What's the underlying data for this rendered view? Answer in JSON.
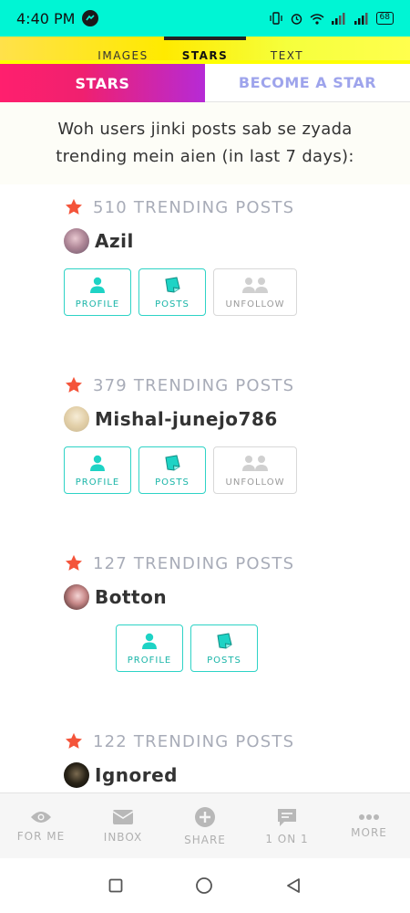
{
  "status_bar": {
    "time": "4:40 PM",
    "battery": "68"
  },
  "top_tabs": [
    {
      "label": "IMAGES",
      "active": false
    },
    {
      "label": "STARS",
      "active": true
    },
    {
      "label": "TEXT",
      "active": false
    }
  ],
  "sub_tabs": {
    "stars": "STARS",
    "become_star": "BECOME A STAR"
  },
  "intro": "Woh users jinki posts sab se zyada trending mein aien (in last 7 days):",
  "entries": [
    {
      "count": "510 TRENDING POSTS",
      "name": "Azil",
      "profile": "PROFILE",
      "posts": "POSTS",
      "unfollow": "UNFOLLOW"
    },
    {
      "count": "379 TRENDING POSTS",
      "name": "Mishal-junejo786",
      "profile": "PROFILE",
      "posts": "POSTS",
      "unfollow": "UNFOLLOW"
    },
    {
      "count": "127 TRENDING POSTS",
      "name": "Botton",
      "profile": "PROFILE",
      "posts": "POSTS"
    },
    {
      "count": "122 TRENDING POSTS",
      "name": "Ignored"
    }
  ],
  "bottom_nav": [
    {
      "label": "FOR ME",
      "icon": "eye-icon"
    },
    {
      "label": "INBOX",
      "icon": "envelope-icon"
    },
    {
      "label": "SHARE",
      "icon": "plus-circle-icon"
    },
    {
      "label": "1 ON 1",
      "icon": "chat-icon"
    },
    {
      "label": "MORE",
      "icon": "more-dots-icon"
    }
  ],
  "colors": {
    "accent": "#2ed3c6",
    "star": "#f4543a",
    "status_bar": "#00f5d4"
  }
}
